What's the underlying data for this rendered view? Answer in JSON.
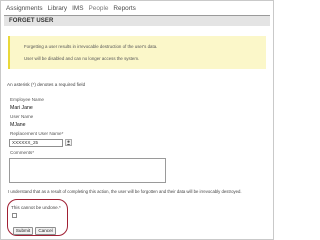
{
  "nav": {
    "items": [
      {
        "label": "Assignments"
      },
      {
        "label": "Library"
      },
      {
        "label": "IMS"
      },
      {
        "label": "People",
        "active": true
      },
      {
        "label": "Reports"
      }
    ]
  },
  "page": {
    "title": "FORGET USER"
  },
  "warning": {
    "line1": "Forgetting a user results in irrevocable destruction of the user's data.",
    "line2": "User will be disabled and can no longer access the system."
  },
  "form": {
    "required_note": "An asterisk (*) denotes a required field",
    "employee_name_label": "Employee Name",
    "employee_name_value": "Mari Jane",
    "user_name_label": "User Name",
    "user_name_value": "MJane",
    "replacement_label": "Replacement User Name*",
    "replacement_value": "XXXXXX_25",
    "comments_label": "Comments*",
    "comments_value": "",
    "understand_text": "I understand that as a result of completing this action, the user will be forgotten and their data will be irrevocably destroyed.",
    "undone_label": "This cannot be undone.*",
    "undone_checked": false,
    "submit_label": "Submit",
    "cancel_label": "Cancel"
  },
  "icons": {
    "replacement_picker": "user-picker-icon"
  },
  "colors": {
    "warning_bg": "#fbf7c9",
    "warning_border": "#e9d83a",
    "highlight": "#a02033"
  }
}
